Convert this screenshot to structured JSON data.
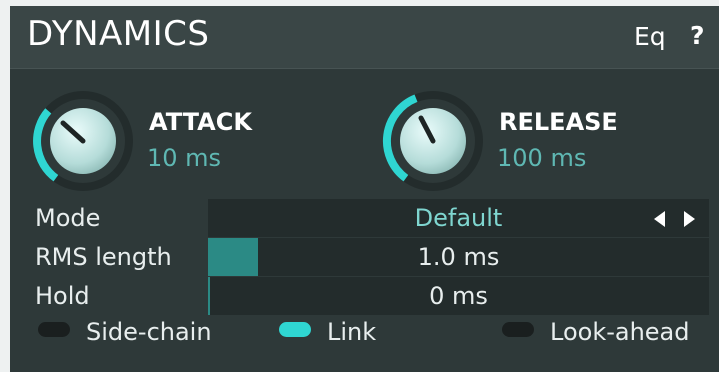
{
  "header": {
    "title": "DYNAMICS",
    "eq_label": "Eq",
    "help_label": "?"
  },
  "knobs": [
    {
      "name": "ATTACK",
      "value": "10 ms"
    },
    {
      "name": "RELEASE",
      "value": "100 ms"
    }
  ],
  "rows": {
    "mode": {
      "label": "Mode",
      "value": "Default"
    },
    "rms": {
      "label": "RMS length",
      "value": "1.0 ms",
      "fill": 0.1
    },
    "hold": {
      "label": "Hold",
      "value": "0 ms",
      "fill": 0.0
    }
  },
  "toggles": [
    {
      "label": "Side-chain",
      "on": false
    },
    {
      "label": "Link",
      "on": true
    },
    {
      "label": "Look-ahead",
      "on": false
    }
  ],
  "colors": {
    "accent": "#2fd6d2",
    "value_text": "#5fb8b3",
    "panel": "#2e3939"
  }
}
